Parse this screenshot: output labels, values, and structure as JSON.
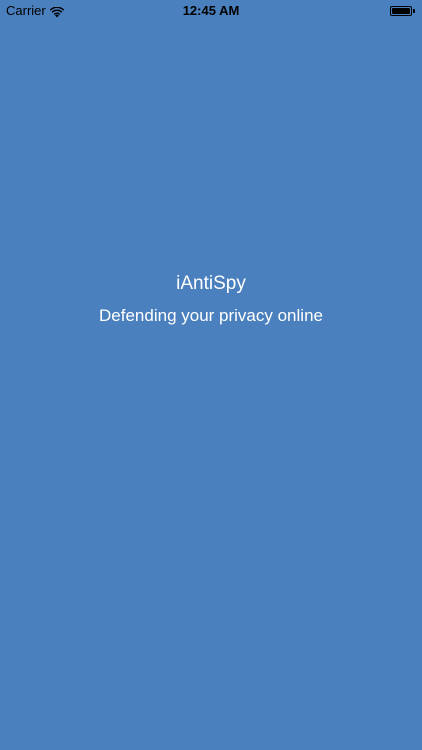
{
  "status_bar": {
    "carrier": "Carrier",
    "time": "12:45 AM",
    "wifi_icon": "wifi-icon",
    "battery_icon": "battery-full-icon",
    "battery_level": 1.0
  },
  "splash": {
    "title": "iAntiSpy",
    "tagline": "Defending your privacy online",
    "background_color": "#4a80bd",
    "text_color": "#ffffff"
  }
}
